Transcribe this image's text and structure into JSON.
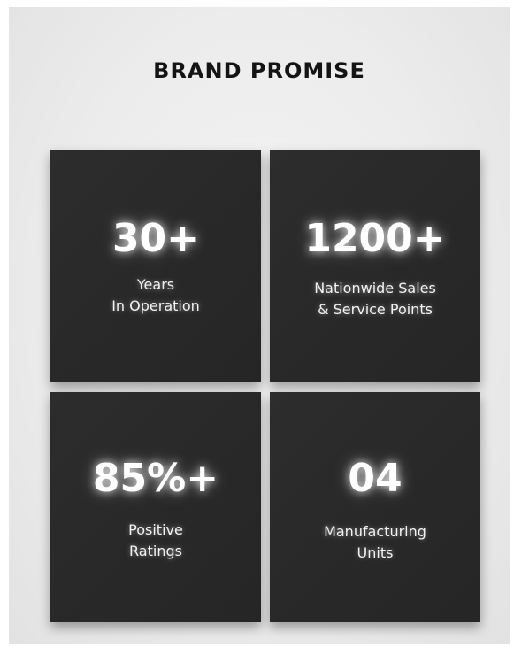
{
  "header": {
    "title": "BRAND PROMISE"
  },
  "stats": [
    {
      "value": "30+",
      "label_lines": [
        "Years",
        "In Operation"
      ]
    },
    {
      "value": "1200+",
      "label_lines": [
        "Nationwide Sales",
        "& Service Points"
      ]
    },
    {
      "value": "85%+",
      "label_lines": [
        "Positive",
        "Ratings"
      ]
    },
    {
      "value": "04",
      "label_lines": [
        "Manufacturing",
        "Units"
      ]
    }
  ],
  "colors": {
    "background": "#ececec",
    "tile": "#2a2a2a",
    "title": "#141414",
    "stat_text": "#ffffff"
  }
}
